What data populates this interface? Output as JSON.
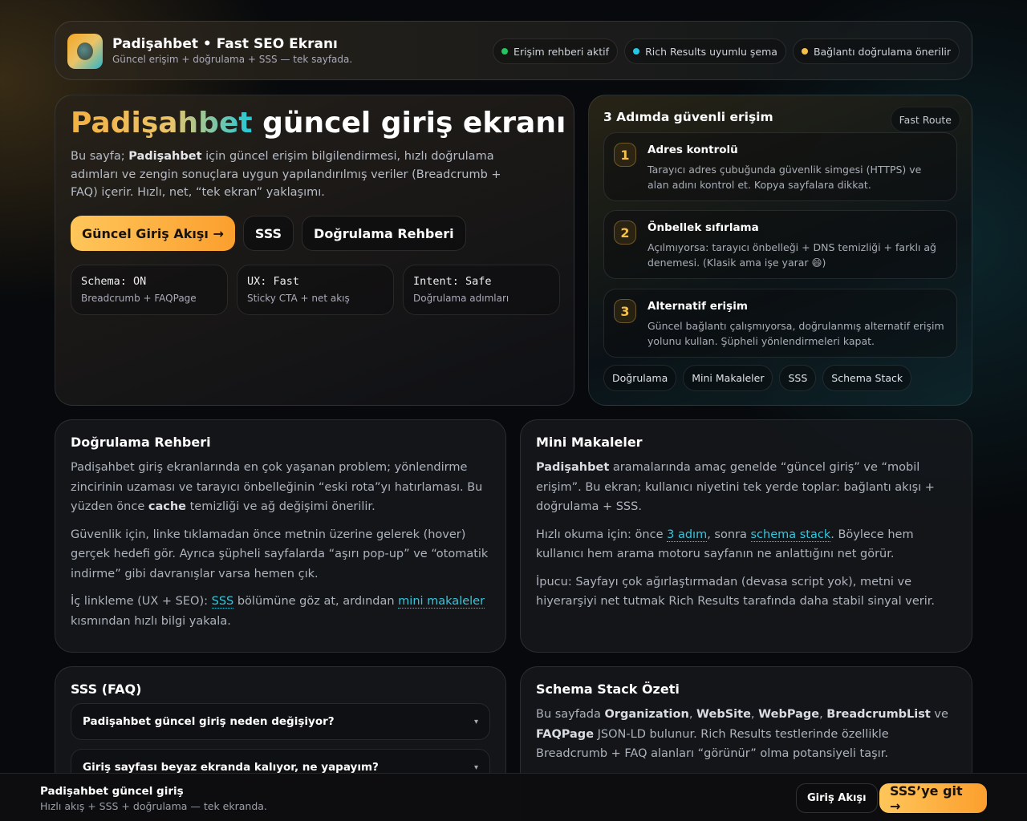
{
  "header": {
    "title": "Padişahbet • Fast SEO Ekranı",
    "subtitle": "Güncel erişim + doğrulama + SSS — tek sayfada.",
    "pills": [
      {
        "label": "Erişim rehberi aktif",
        "color": "#22c55e"
      },
      {
        "label": "Rich Results uyumlu şema",
        "color": "#22c8e8"
      },
      {
        "label": "Bağlantı doğrulama önerilir",
        "color": "#f5c04a"
      }
    ]
  },
  "hero": {
    "title_brand": "Padişahbet",
    "title_rest": " güncel giriş ekranı",
    "lead": [
      {
        "t": "Bu sayfa; "
      },
      {
        "t": "Padişahbet",
        "b": 1
      },
      {
        "t": " için güncel erişim bilgilendirmesi, hızlı doğrulama adımları ve zengin sonuçlara uygun yapılandırılmış veriler (Breadcrumb + FAQ) içerir. Hızlı, net, “tek ekran” yaklaşımı."
      }
    ],
    "buttons": {
      "primary": "Güncel Giriş Akışı →",
      "faq": "SSS",
      "guide": "Doğrulama Rehberi"
    },
    "stats": [
      {
        "k": "Schema: ON",
        "v": "Breadcrumb + FAQPage"
      },
      {
        "k": "UX: Fast",
        "v": "Sticky CTA + net akış"
      },
      {
        "k": "Intent: Safe",
        "v": "Doğrulama adımları"
      }
    ]
  },
  "steps": {
    "title": "3 Adımda güvenli erişim",
    "badge": "Fast Route",
    "items": [
      {
        "n": "1",
        "t": "Adres kontrolü",
        "d": "Tarayıcı adres çubuğunda güvenlik simgesi (HTTPS) ve alan adını kontrol et. Kopya sayfalara dikkat."
      },
      {
        "n": "2",
        "t": "Önbellek sıfırlama",
        "d": "Açılmıyorsa: tarayıcı önbelleği + DNS temizliği + farklı ağ denemesi. (Klasik ama işe yarar 😄)"
      },
      {
        "n": "3",
        "t": "Alternatif erişim",
        "d": "Güncel bağlantı çalışmıyorsa, doğrulanmış alternatif erişim yolunu kullan. Şüpheli yönlendirmeleri kapat."
      }
    ],
    "chips": [
      "Doğrulama",
      "Mini Makaleler",
      "SSS",
      "Schema Stack"
    ]
  },
  "guide": {
    "title": "Doğrulama Rehberi",
    "p": [
      [
        {
          "t": "Padişahbet giriş ekranlarında en çok yaşanan problem; yönlendirme zincirinin uzaması ve tarayıcı önbelleğinin “eski rota”yı hatırlaması. Bu yüzden önce "
        },
        {
          "t": "cache",
          "b": 1
        },
        {
          "t": " temizliği ve ağ değişimi önerilir."
        }
      ],
      [
        {
          "t": "Güvenlik için, linke tıklamadan önce metnin üzerine gelerek (hover) gerçek hedefi gör. Ayrıca şüpheli sayfalarda “aşırı pop-up” ve “otomatik indirme” gibi davranışlar varsa hemen çık."
        }
      ],
      [
        {
          "t": "İç linkleme (UX + SEO): "
        },
        {
          "t": "SSS",
          "a": 1
        },
        {
          "t": " bölümüne göz at, ardından "
        },
        {
          "t": "mini makaleler",
          "a": 1
        },
        {
          "t": " kısmından hızlı bilgi yakala."
        }
      ]
    ]
  },
  "articles": {
    "title": "Mini Makaleler",
    "p": [
      [
        {
          "t": "Padişahbet",
          "b": 1
        },
        {
          "t": " aramalarında amaç genelde “güncel giriş” ve “mobil erişim”. Bu ekran; kullanıcı niyetini tek yerde toplar: bağlantı akışı + doğrulama + SSS."
        }
      ],
      [
        {
          "t": "Hızlı okuma için: önce "
        },
        {
          "t": "3 adım",
          "a": 1
        },
        {
          "t": ", sonra "
        },
        {
          "t": "schema stack",
          "a": 1
        },
        {
          "t": ". Böylece hem kullanıcı hem arama motoru sayfanın ne anlattığını net görür."
        }
      ],
      [
        {
          "t": "İpucu: Sayfayı çok ağırlaştırmadan (devasa script yok), metni ve hiyerarşiyi net tutmak Rich Results tarafında daha stabil sinyal verir."
        }
      ]
    ]
  },
  "faq": {
    "title": "SSS (FAQ)",
    "items": [
      "Padişahbet güncel giriş neden değişiyor?",
      "Giriş sayfası beyaz ekranda kalıyor, ne yapayım?"
    ],
    "chevron": "▾"
  },
  "schema": {
    "title": "Schema Stack Özeti",
    "p": [
      [
        {
          "t": "Bu sayfada "
        },
        {
          "t": "Organization",
          "b": 1
        },
        {
          "t": ", "
        },
        {
          "t": "WebSite",
          "b": 1
        },
        {
          "t": ", "
        },
        {
          "t": "WebPage",
          "b": 1
        },
        {
          "t": ", "
        },
        {
          "t": "BreadcrumbList",
          "b": 1
        },
        {
          "t": " ve "
        },
        {
          "t": "FAQPage",
          "b": 1
        },
        {
          "t": " JSON-LD bulunur. Rich Results testlerinde özellikle Breadcrumb + FAQ alanları “görünür” olma potansiyeli taşır."
        }
      ]
    ]
  },
  "bottom": {
    "title": "Padişahbet güncel giriş",
    "subtitle": "Hızlı akış + SSS + doğrulama — tek ekranda.",
    "secondary": "Giriş Akışı",
    "primary": "SSS’ye git →"
  }
}
